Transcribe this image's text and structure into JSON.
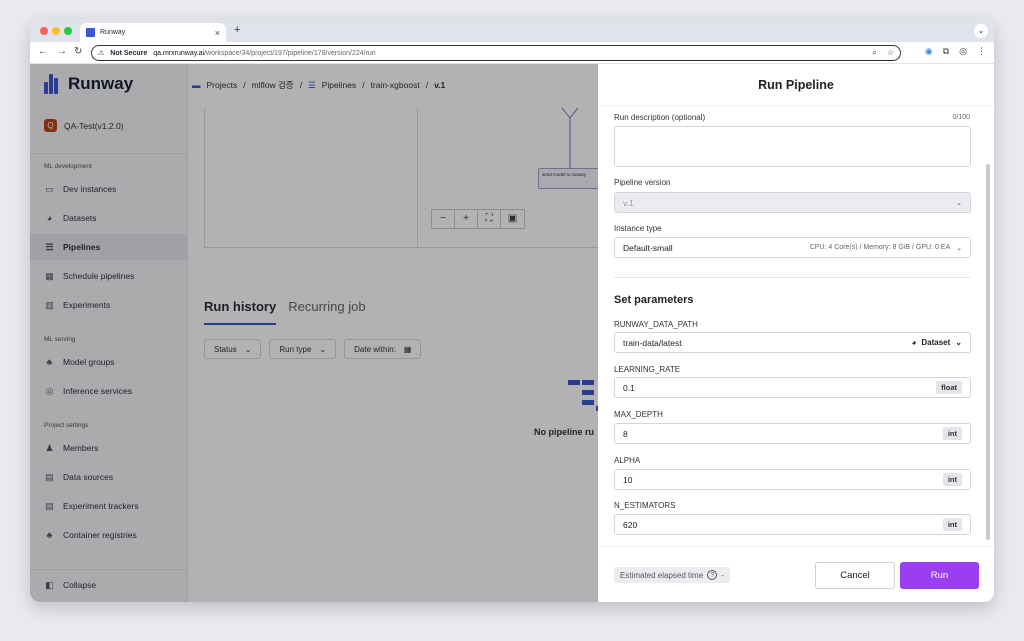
{
  "browser": {
    "tab_title": "Runway",
    "new_tab": "+",
    "not_secure": "Not Secure",
    "url_host": "qa.mrxrunway.ai",
    "url_path": "/workspace/34/project/197/pipeline/178/version/224/run"
  },
  "sidebar": {
    "brand": "Runway",
    "project": {
      "badge": "Q",
      "name": "QA-Test(v1.2.0)"
    },
    "sections": [
      {
        "title": "ML development"
      },
      {
        "title": "ML serving"
      },
      {
        "title": "Project settings"
      }
    ],
    "items": [
      {
        "label": "Dev instances",
        "icon": "monitor-icon"
      },
      {
        "label": "Datasets",
        "icon": "database-icon"
      },
      {
        "label": "Pipelines",
        "icon": "pipeline-icon"
      },
      {
        "label": "Schedule pipelines",
        "icon": "calendar-icon"
      },
      {
        "label": "Experiments",
        "icon": "chart-icon"
      },
      {
        "label": "Model groups",
        "icon": "model-icon"
      },
      {
        "label": "Inference services",
        "icon": "inference-icon"
      },
      {
        "label": "Members",
        "icon": "users-icon"
      },
      {
        "label": "Data sources",
        "icon": "datasource-icon"
      },
      {
        "label": "Experiment trackers",
        "icon": "tracker-icon"
      },
      {
        "label": "Container registries",
        "icon": "registry-icon"
      }
    ],
    "collapse": "Collapse"
  },
  "breadcrumb": {
    "projects": "Projects",
    "sep": "/",
    "project": "mlflow 검증",
    "pipelines": "Pipelines",
    "pipeline": "train-xgboost",
    "version": "v.1"
  },
  "canvas": {
    "node_label": "send model to runway"
  },
  "run_tabs": {
    "history": "Run history",
    "recurring": "Recurring job"
  },
  "filters": {
    "status": "Status",
    "run_type": "Run type",
    "date": "Date within:"
  },
  "empty": {
    "text": "No pipeline ru"
  },
  "drawer": {
    "title": "Run Pipeline",
    "description": {
      "label": "Run description (optional)",
      "counter": "0/100",
      "value": ""
    },
    "version": {
      "label": "Pipeline version",
      "value": "v.1"
    },
    "instance": {
      "label": "Instance type",
      "value": "Default-small",
      "spec": "CPU: 4 Core(s) / Memory: 8 GiB / GPU: 0 EA"
    },
    "params_title": "Set parameters",
    "params": [
      {
        "name": "RUNWAY_DATA_PATH",
        "value": "train-data/latest",
        "type": "Dataset"
      },
      {
        "name": "LEARNING_RATE",
        "value": "0.1",
        "type": "float"
      },
      {
        "name": "MAX_DEPTH",
        "value": "8",
        "type": "int"
      },
      {
        "name": "ALPHA",
        "value": "10",
        "type": "int"
      },
      {
        "name": "N_ESTIMATORS",
        "value": "620",
        "type": "int"
      }
    ],
    "elapsed": "Estimated elapsed time",
    "elapsed_value": "-",
    "cancel": "Cancel",
    "run": "Run"
  }
}
